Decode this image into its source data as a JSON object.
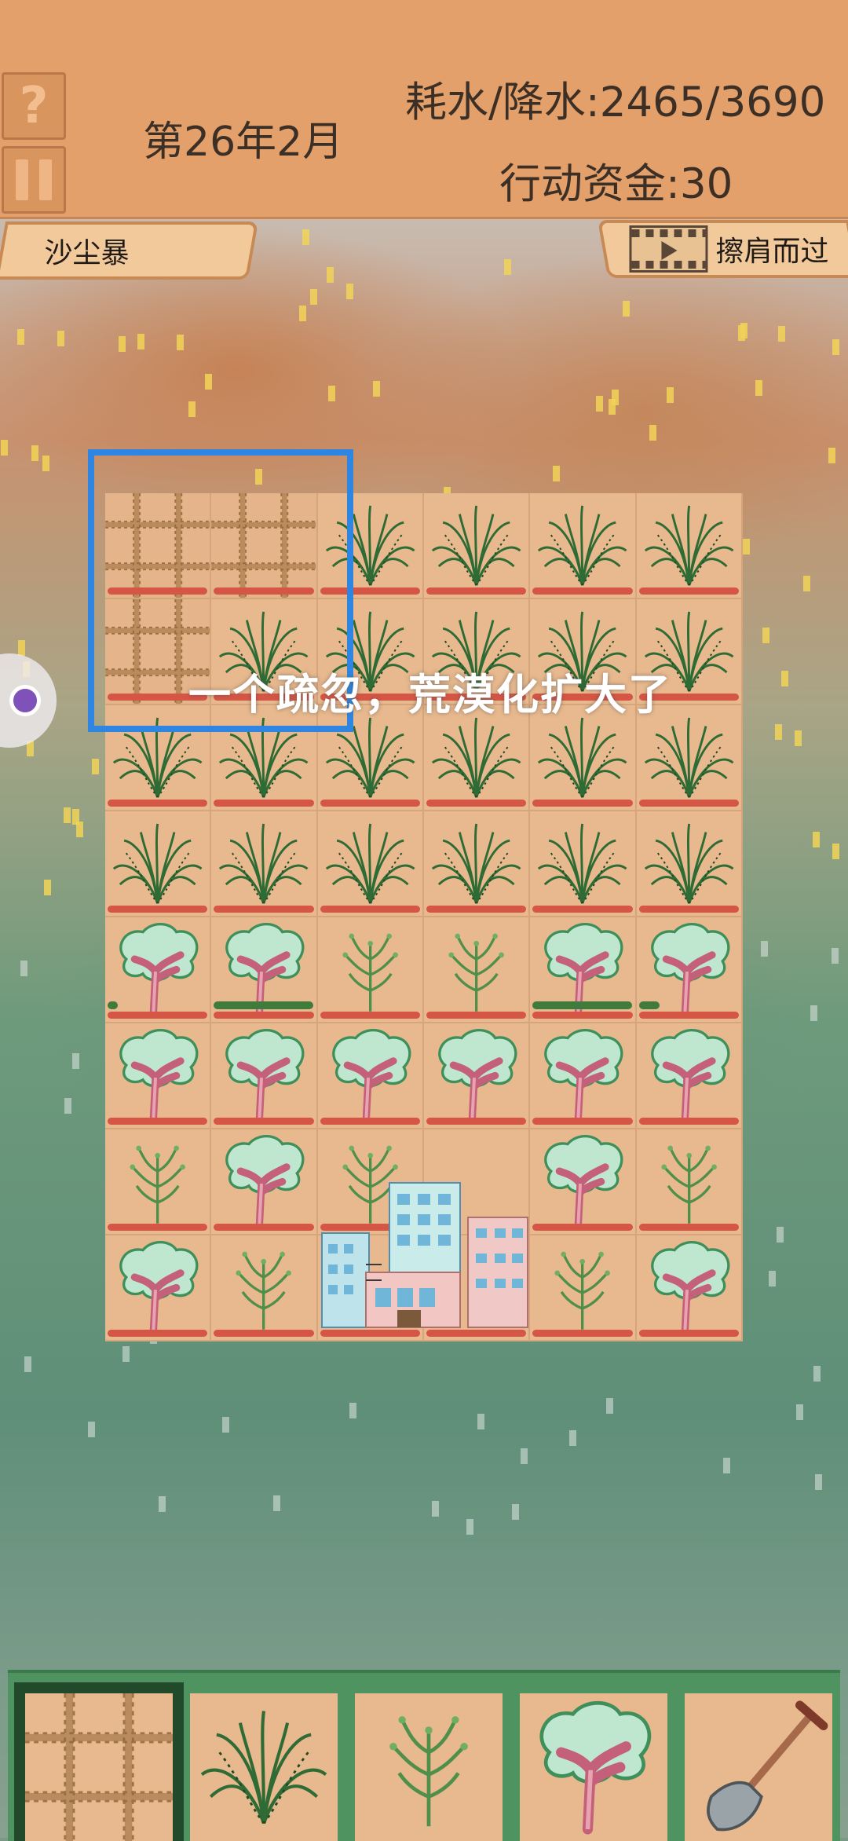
{
  "hud": {
    "help_icon": "question-mark-icon",
    "pause_icon": "pause-icon",
    "date": "第26年2月",
    "water_ratio": "耗水/降水:2465/3690",
    "funds": "行动资金:30"
  },
  "event_tag": "沙尘暴",
  "video_tag": {
    "icon": "film-strip-icon",
    "label": "擦肩而过"
  },
  "message": "一个疏忽，荒漠化扩大了",
  "grid": {
    "rows": [
      [
        "mesh",
        "mesh",
        "shrub",
        "shrub",
        "shrub",
        "shrub"
      ],
      [
        "mesh",
        "shrub",
        "shrub",
        "shrub",
        "shrub",
        "shrub"
      ],
      [
        "shrub",
        "shrub",
        "shrub",
        "shrub",
        "shrub",
        "shrub"
      ],
      [
        "shrub",
        "shrub",
        "shrub",
        "shrub",
        "shrub",
        "shrub"
      ],
      [
        "tree",
        "tree",
        "sapling",
        "sapling",
        "tree",
        "tree"
      ],
      [
        "tree",
        "tree",
        "tree",
        "tree",
        "tree",
        "tree"
      ],
      [
        "sapling",
        "tree",
        "sapling",
        "building",
        "tree",
        "sapling"
      ],
      [
        "tree",
        "sapling",
        "building",
        "building",
        "sapling",
        "tree"
      ]
    ],
    "growth_row5": [
      0.1,
      0.95,
      0,
      0,
      0.95,
      0.2
    ],
    "selection": {
      "row": 0,
      "col": 0,
      "rows": 2,
      "cols": 2
    }
  },
  "toolbar": {
    "tools": [
      {
        "name": "straw-checkerboard",
        "icon": "straw-grid-icon",
        "selected": true
      },
      {
        "name": "shrub",
        "icon": "shrub-icon",
        "selected": false
      },
      {
        "name": "sapling",
        "icon": "sapling-icon",
        "selected": false
      },
      {
        "name": "tree",
        "icon": "tree-icon",
        "selected": false
      },
      {
        "name": "shovel",
        "icon": "shovel-icon",
        "selected": false
      }
    ]
  },
  "colors": {
    "hud_bg": "#e4a06a",
    "selection": "#2e86e2",
    "health_bar": "#d65645",
    "growth_bar": "#3f7b3a",
    "dust": "#f1d357"
  }
}
